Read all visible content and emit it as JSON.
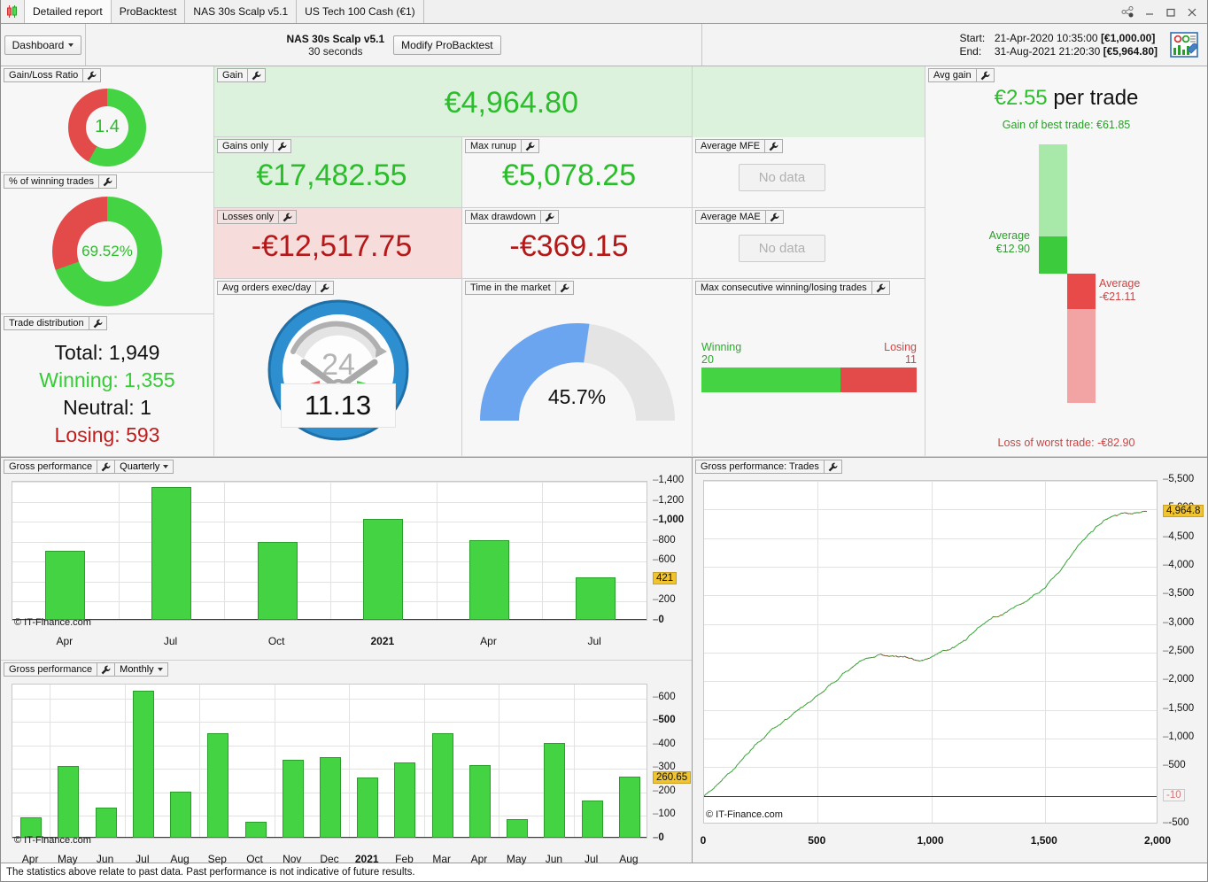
{
  "window": {
    "app_icon": "candlestick-icon",
    "controls": [
      "share-icon",
      "minimize",
      "maximize",
      "close"
    ]
  },
  "tabs": [
    {
      "label": "Detailed report",
      "active": true
    },
    {
      "label": "ProBacktest",
      "active": false
    },
    {
      "label": "NAS 30s Scalp v5.1",
      "active": false
    },
    {
      "label": "US Tech 100 Cash (€1)",
      "active": false
    }
  ],
  "toolbar": {
    "dashboard_label": "Dashboard",
    "strategy_name": "NAS 30s  Scalp v5.1",
    "strategy_timeframe": "30 seconds",
    "modify_label": "Modify ProBacktest",
    "start_label": "Start:",
    "start_value": "21-Apr-2020 10:35:00",
    "start_amount": "[€1,000.00]",
    "end_label": "End:",
    "end_value": "31-Aug-2021 21:20:30",
    "end_amount": "[€5,964.80]"
  },
  "panels": {
    "gain_loss_ratio": {
      "title": "Gain/Loss Ratio",
      "value": "1.4",
      "green_pct": 58,
      "red_pct": 42
    },
    "winning_pct": {
      "title": "% of winning trades",
      "value": "69.52%",
      "green_pct": 69.52,
      "red_pct": 30.48
    },
    "trade_distribution": {
      "title": "Trade distribution",
      "total_label": "Total:",
      "total_value": "1,949",
      "winning_label": "Winning:",
      "winning_value": "1,355",
      "neutral_label": "Neutral:",
      "neutral_value": "1",
      "losing_label": "Losing:",
      "losing_value": "593"
    },
    "gain": {
      "title": "Gain",
      "value": "€4,964.80"
    },
    "gains_only": {
      "title": "Gains only",
      "value": "€17,482.55"
    },
    "losses_only": {
      "title": "Losses only",
      "value": "-€12,517.75"
    },
    "max_runup": {
      "title": "Max runup",
      "value": "€5,078.25"
    },
    "max_drawdown": {
      "title": "Max drawdown",
      "value": "-€369.15"
    },
    "average_mfe": {
      "title": "Average MFE",
      "value": "No data"
    },
    "average_mae": {
      "title": "Average MAE",
      "value": "No data"
    },
    "avg_orders": {
      "title": "Avg orders exec/day",
      "value": "11.13",
      "clock_label": "24"
    },
    "time_in_market": {
      "title": "Time in the market",
      "value": "45.7%",
      "pct": 45.7
    },
    "max_consecutive": {
      "title": "Max consecutive winning/losing trades",
      "winning_label": "Winning",
      "winning_value": "20",
      "losing_label": "Losing",
      "losing_value": "11"
    },
    "avg_gain": {
      "title": "Avg gain",
      "headline_value": "€2.55",
      "headline_suffix": " per trade",
      "best_label": "Gain of best trade:  €61.85",
      "avg_gain_label": "Average",
      "avg_gain_value": "€12.90",
      "avg_loss_label": "Average",
      "avg_loss_value": "-€21.11",
      "worst_label": "Loss of worst trade: -€82.90"
    }
  },
  "charts": {
    "quarterly": {
      "title": "Gross performance",
      "period": "Quarterly",
      "copyright": "© IT-Finance.com"
    },
    "monthly": {
      "title": "Gross performance",
      "period": "Monthly",
      "copyright": "© IT-Finance.com"
    },
    "trades": {
      "title": "Gross performance: Trades",
      "copyright": "© IT-Finance.com"
    }
  },
  "statusbar": {
    "text": "The statistics above relate to past data. Past performance is not indicative of future results."
  },
  "chart_data": [
    {
      "type": "bar",
      "name": "quarterly",
      "title": "Gross performance - Quarterly",
      "categories": [
        "Apr",
        "Jul",
        "Oct",
        "2021",
        "Apr",
        "Jul"
      ],
      "values": [
        690,
        1330,
        780,
        1010,
        800,
        421
      ],
      "yticks": [
        0,
        200,
        400,
        600,
        800,
        1000,
        1200,
        1400
      ],
      "ytick_labels": [
        "0",
        "200",
        "400",
        "600",
        "800",
        "1,000",
        "1,200",
        "1,400"
      ],
      "bold_yticks": [
        "0",
        "1,000"
      ],
      "ylim": [
        0,
        1400
      ],
      "last_value_badge": "421",
      "xlabel": "",
      "ylabel": "",
      "grid": true
    },
    {
      "type": "bar",
      "name": "monthly",
      "title": "Gross performance - Monthly",
      "categories": [
        "Apr",
        "May",
        "Jun",
        "Jul",
        "Aug",
        "Sep",
        "Oct",
        "Nov",
        "Dec",
        "2021",
        "Feb",
        "Mar",
        "Apr",
        "May",
        "Jun",
        "Jul",
        "Aug"
      ],
      "values": [
        85,
        305,
        130,
        625,
        195,
        445,
        68,
        330,
        345,
        255,
        320,
        445,
        310,
        78,
        405,
        160,
        260.65
      ],
      "yticks": [
        0,
        100,
        200,
        300,
        400,
        500,
        600
      ],
      "ytick_labels": [
        "0",
        "100",
        "200",
        "300",
        "400",
        "500",
        "600"
      ],
      "bold_yticks": [
        "0",
        "500"
      ],
      "ylim": [
        0,
        660
      ],
      "last_value_badge": "260.65",
      "xlabel": "",
      "ylabel": "",
      "grid": true
    },
    {
      "type": "line",
      "name": "trades_equity",
      "title": "Gross performance: Trades",
      "xlabel": "",
      "ylabel": "",
      "xticks": [
        0,
        500,
        1000,
        1500,
        2000
      ],
      "xtick_labels": [
        "0",
        "500",
        "1,000",
        "1,500",
        "2,000"
      ],
      "yticks": [
        -500,
        0,
        500,
        1000,
        1500,
        2000,
        2500,
        3000,
        3500,
        4000,
        4500,
        5000,
        5500
      ],
      "ytick_labels": [
        "-500",
        "0",
        "500",
        "1,000",
        "1,500",
        "2,000",
        "2,500",
        "3,000",
        "3,500",
        "4,000",
        "4,500",
        "5,000",
        "5,500"
      ],
      "ylim": [
        -500,
        5500
      ],
      "xlim": [
        0,
        2000
      ],
      "zero_line_value": -10,
      "zero_badge": "-10",
      "last_value_badge": "4,964.8",
      "final_value": 4964.8,
      "x_end": 1949,
      "grid": true
    }
  ],
  "colors": {
    "green": "#43d343",
    "green_dark": "#2a9e2a",
    "green_text": "#18a018",
    "red": "#e34b4b",
    "red_text": "#b51818",
    "blue": "#6ba5ef",
    "accent_badge": "#f0c330"
  }
}
